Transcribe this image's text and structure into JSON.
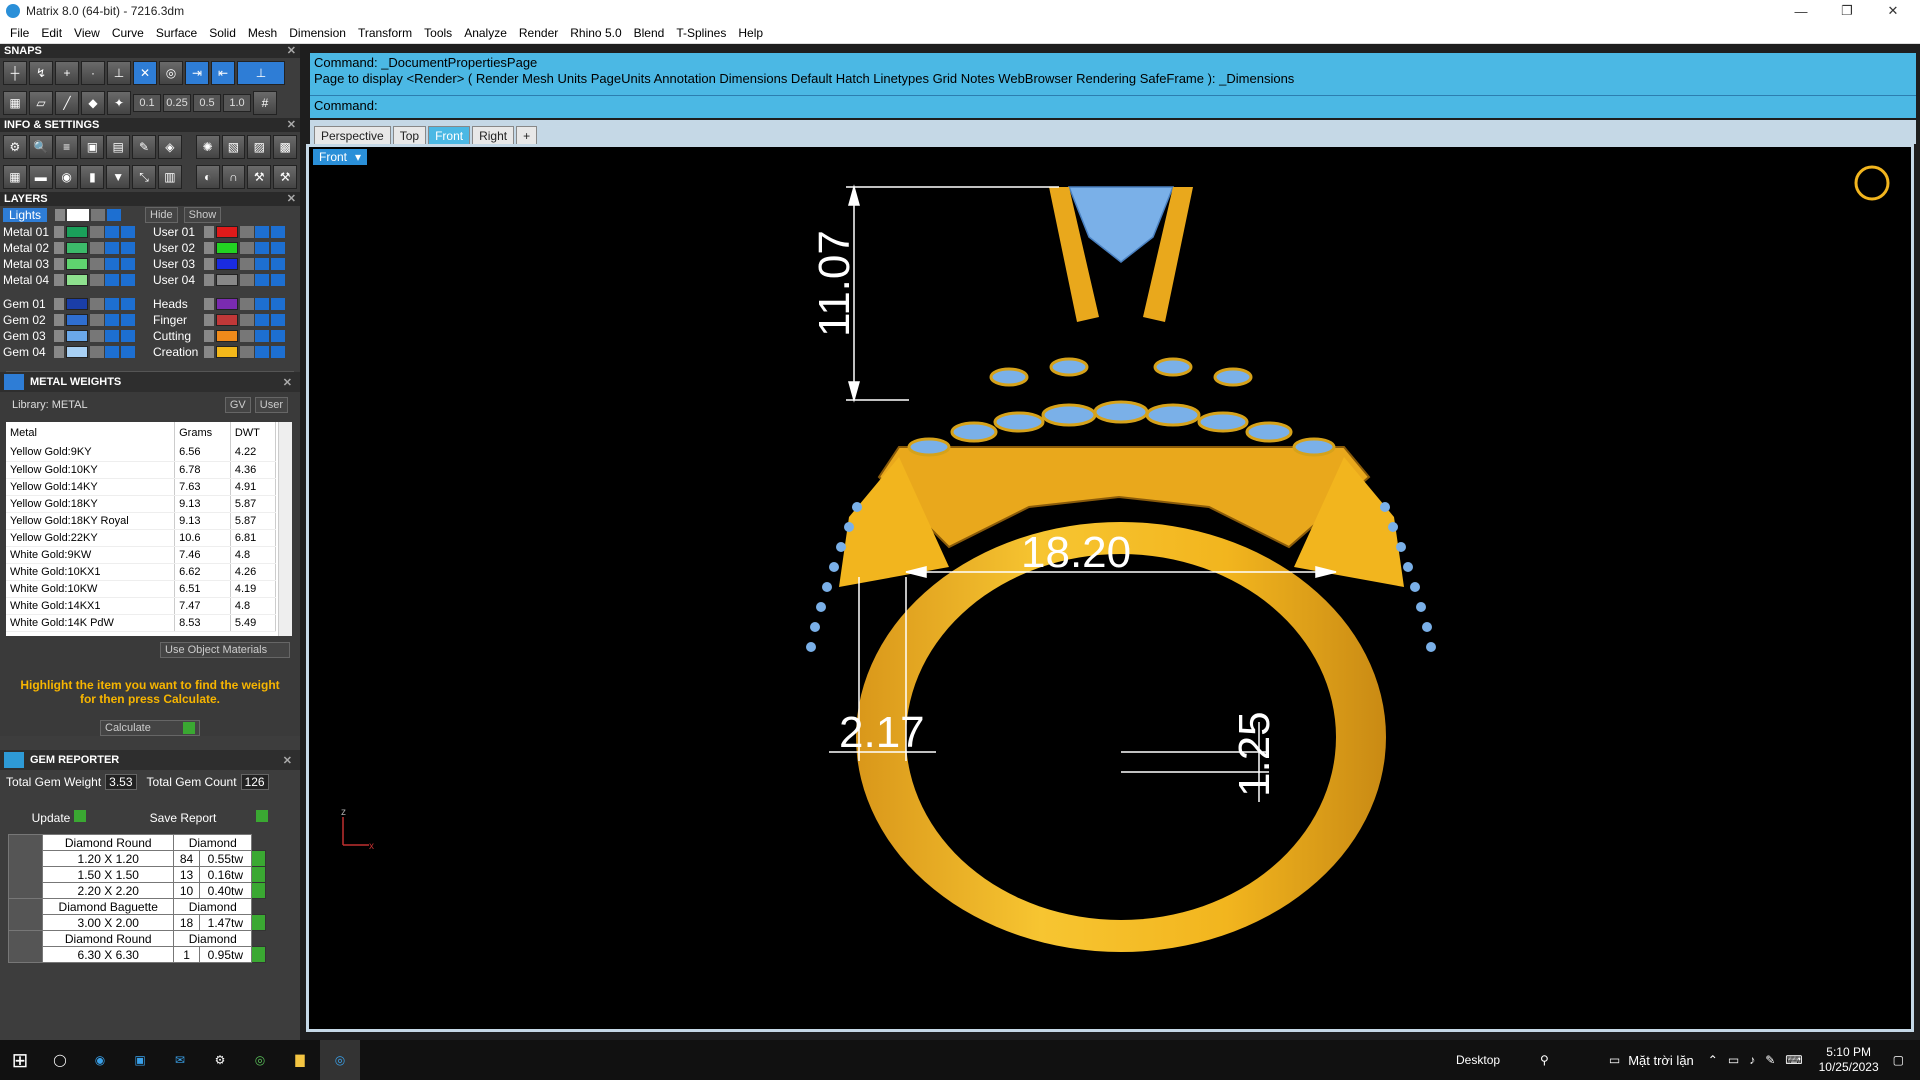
{
  "window": {
    "title": "Matrix 8.0 (64-bit) - 7216.3dm"
  },
  "menu": [
    "File",
    "Edit",
    "View",
    "Curve",
    "Surface",
    "Solid",
    "Mesh",
    "Dimension",
    "Transform",
    "Tools",
    "Analyze",
    "Render",
    "Rhino 5.0",
    "Blend",
    "T-Splines",
    "Help"
  ],
  "panels": {
    "snaps": "SNAPS",
    "info": "INFO & SETTINGS",
    "layers": "LAYERS",
    "metal_weights": "METAL WEIGHTS",
    "gem_reporter": "GEM REPORTER"
  },
  "snap_values": [
    "0.1",
    "0.25",
    "0.5",
    "1.0"
  ],
  "layers": {
    "lights": "Lights",
    "hide": "Hide",
    "show": "Show",
    "left": [
      {
        "name": "Metal 01",
        "color": "#1aa05a"
      },
      {
        "name": "Metal 02",
        "color": "#3cba6a"
      },
      {
        "name": "Metal 03",
        "color": "#5fd36f"
      },
      {
        "name": "Metal 04",
        "color": "#8ee08e"
      },
      {
        "name": "Gem 01",
        "color": "#1a3ea8"
      },
      {
        "name": "Gem 02",
        "color": "#2f6ed0"
      },
      {
        "name": "Gem 03",
        "color": "#6aa8ea"
      },
      {
        "name": "Gem 04",
        "color": "#a8d0f4"
      }
    ],
    "right": [
      {
        "name": "User 01",
        "color": "#e01a1a"
      },
      {
        "name": "User 02",
        "color": "#22d322"
      },
      {
        "name": "User 03",
        "color": "#1a2be0"
      },
      {
        "name": "User 04",
        "color": "#888888"
      },
      {
        "name": "Heads",
        "color": "#7a2bb0"
      },
      {
        "name": "Finger",
        "color": "#c03838"
      },
      {
        "name": "Cutting",
        "color": "#f08a1a"
      },
      {
        "name": "Creation",
        "color": "#f4b81a"
      }
    ]
  },
  "metal_weights": {
    "library": "Library: METAL",
    "gv": "GV",
    "user": "User",
    "headers": [
      "Metal",
      "Grams",
      "DWT"
    ],
    "rows": [
      [
        "Yellow Gold:9KY",
        "6.56",
        "4.22"
      ],
      [
        "Yellow Gold:10KY",
        "6.78",
        "4.36"
      ],
      [
        "Yellow Gold:14KY",
        "7.63",
        "4.91"
      ],
      [
        "Yellow Gold:18KY",
        "9.13",
        "5.87"
      ],
      [
        "Yellow Gold:18KY Royal",
        "9.13",
        "5.87"
      ],
      [
        "Yellow Gold:22KY",
        "10.6",
        "6.81"
      ],
      [
        "White Gold:9KW",
        "7.46",
        "4.8"
      ],
      [
        "White Gold:10KX1",
        "6.62",
        "4.26"
      ],
      [
        "White Gold:10KW",
        "6.51",
        "4.19"
      ],
      [
        "White Gold:14KX1",
        "7.47",
        "4.8"
      ],
      [
        "White Gold:14K PdW",
        "8.53",
        "5.49"
      ]
    ],
    "use_object_materials": "Use Object Materials",
    "hint": "Highlight the item you want to find the weight for then press Calculate.",
    "calculate": "Calculate"
  },
  "gem_reporter": {
    "total_weight_label": "Total Gem Weight",
    "total_weight": "3.53",
    "total_count_label": "Total Gem Count",
    "total_count": "126",
    "update": "Update",
    "save_report": "Save Report",
    "groups": [
      {
        "shape": "Diamond Round",
        "material": "Diamond",
        "rows": [
          [
            "1.20 X 1.20",
            "84",
            "0.55tw"
          ],
          [
            "1.50 X 1.50",
            "13",
            "0.16tw"
          ],
          [
            "2.20 X 2.20",
            "10",
            "0.40tw"
          ]
        ]
      },
      {
        "shape": "Diamond Baguette",
        "material": "Diamond",
        "rows": [
          [
            "3.00 X 2.00",
            "18",
            "1.47tw"
          ]
        ]
      },
      {
        "shape": "Diamond Round",
        "material": "Diamond",
        "rows": [
          [
            "6.30 X 6.30",
            "1",
            "0.95tw"
          ]
        ]
      }
    ]
  },
  "command": {
    "line1": "Command: _DocumentPropertiesPage",
    "line2": "Page to display <Render> ( Render  Mesh  Units  PageUnits  Annotation  Dimensions  Default  Hatch  Linetypes  Grid  Notes  WebBrowser  Rendering  SafeFrame ): _Dimensions",
    "prompt": "Command:"
  },
  "viewport_tabs": [
    "Perspective",
    "Top",
    "Front",
    "Right"
  ],
  "viewport_label": "Front",
  "dimensions": {
    "height": "11.07",
    "inner": "18.20",
    "shank": "2.17",
    "bottom": "1.25"
  },
  "axis": {
    "z": "z",
    "x": "x"
  },
  "taskbar": {
    "desktop": "Desktop",
    "weather": "Mặt trời lặn",
    "time": "5:10 PM",
    "date": "10/25/2023"
  },
  "colors": {
    "gold": "#f2b51e",
    "gem": "#7ab0e8",
    "cmd": "#4bb8e4"
  }
}
